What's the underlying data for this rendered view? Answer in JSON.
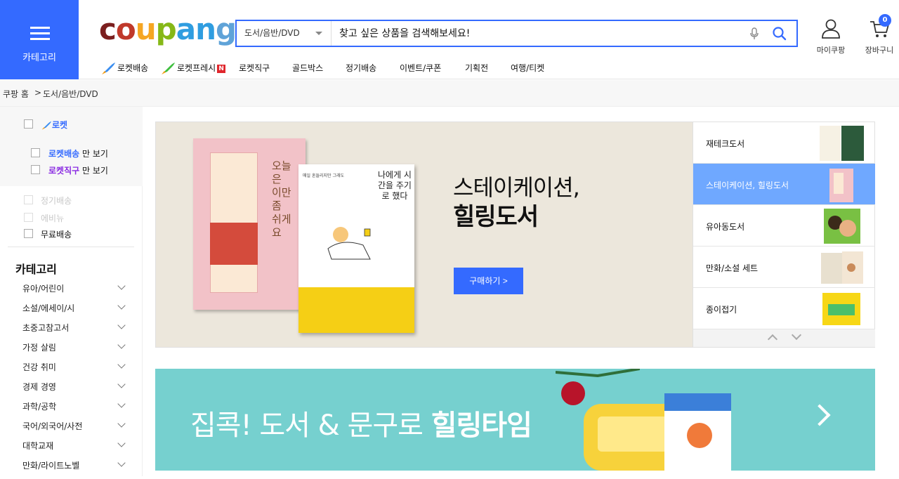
{
  "header": {
    "category_button_label": "카테고리",
    "logo_letters": [
      "c",
      "o",
      "u",
      "p",
      "a",
      "n",
      "g"
    ],
    "search": {
      "selected_category": "도서/음반/DVD",
      "placeholder": "찾고 싶은 상품을 검색해보세요!"
    },
    "my_coupang_label": "마이쿠팡",
    "cart_label": "장바구니",
    "cart_count": "0",
    "nav": [
      "로켓배송",
      "로켓프레시",
      "로켓직구",
      "골드박스",
      "정기배송",
      "이벤트/쿠폰",
      "기획전",
      "여행/티켓"
    ],
    "fresh_badge": "N"
  },
  "breadcrumb": {
    "home": "쿠팡 홈",
    "separator": ">",
    "current": "도서/음반/DVD"
  },
  "sidebar": {
    "rocket_label": "로켓",
    "rocket_delivery_name": "로켓배송",
    "rocket_direct_name": "로켓직구",
    "only_suffix": "만 보기",
    "subscription_label": "정기배송",
    "ecobag_label": "에비뉴",
    "free_shipping_label": "무료배송",
    "category_title": "카테고리",
    "categories": [
      "유아/어린이",
      "소설/에세이/시",
      "초중고참고서",
      "가정 살림",
      "건강 취미",
      "경제 경영",
      "과학/공학",
      "국어/외국어/사전",
      "대학교재",
      "만화/라이트노벨"
    ]
  },
  "hero": {
    "title_line1": "스테이케이션,",
    "title_line2": "힐링도서",
    "buy_button": "구매하기 >",
    "book1_title": "오늘은 이만 좀 쉬게요",
    "book2_small": "매일 혼들리지만 그래도",
    "book2_title": "나에게 시간을 주기로 했다",
    "list": [
      {
        "label": "재테크도서",
        "active": false
      },
      {
        "label": "스테이케이션, 힐링도서",
        "active": true
      },
      {
        "label": "유아동도서",
        "active": false
      },
      {
        "label": "만화/소설 세트",
        "active": false
      },
      {
        "label": "종이접기",
        "active": false
      }
    ]
  },
  "banner2": {
    "text_normal": "집콕! 도서 & 문구로 ",
    "text_bold": "힐링타임"
  },
  "colors": {
    "accent": "#346aff",
    "active_list": "#6fa8ff",
    "banner_teal": "#76d0cf"
  }
}
